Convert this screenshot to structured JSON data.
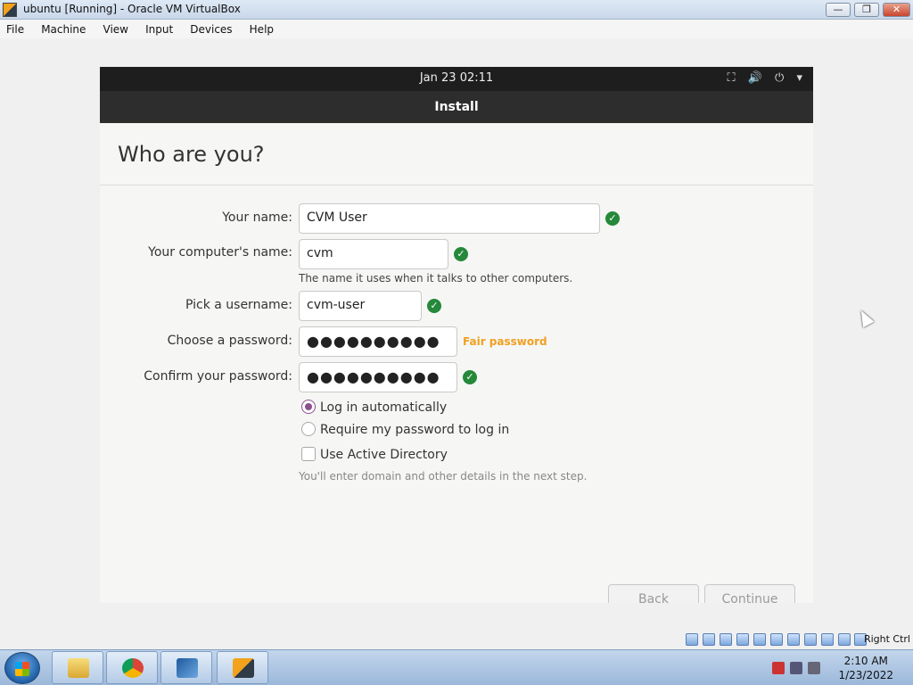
{
  "window": {
    "title": "ubuntu [Running] - Oracle VM VirtualBox",
    "minimize": "—",
    "maximize": "❐",
    "close": "✕"
  },
  "menu": [
    "File",
    "Machine",
    "View",
    "Input",
    "Devices",
    "Help"
  ],
  "guest": {
    "clock": "Jan 23  02:11",
    "tray_icons": [
      "network-icon",
      "volume-icon",
      "power-icon",
      "dropdown-icon"
    ],
    "tray_glyphs": [
      "⛶",
      "🔊",
      "⏻",
      "▾"
    ],
    "header": "Install",
    "page_title": "Who are you?",
    "form": {
      "name_label": "Your name:",
      "name_value": "CVM User",
      "computer_label": "Your computer's name:",
      "computer_value": "cvm",
      "computer_hint": "The name it uses when it talks to other computers.",
      "username_label": "Pick a username:",
      "username_value": "cvm-user",
      "password_label": "Choose a password:",
      "password_value": "●●●●●●●●●●",
      "password_strength": "Fair password",
      "confirm_label": "Confirm your password:",
      "confirm_value": "●●●●●●●●●●",
      "check_glyph": "✓"
    },
    "login_options": {
      "auto": "Log in automatically",
      "require_password": "Require my password to log in",
      "selected": "auto"
    },
    "active_directory": {
      "label": "Use Active Directory",
      "checked": false,
      "hint": "You'll enter domain and other details in the next step."
    },
    "buttons": {
      "back": "Back",
      "continue": "Continue"
    }
  },
  "statusbar": {
    "host_key": "Right Ctrl"
  },
  "taskbar": {
    "apps": [
      "file-explorer",
      "chrome",
      "virtualbox-manager",
      "virtualbox-vm"
    ],
    "time": "2:10 AM",
    "date": "1/23/2022"
  },
  "colors": {
    "ok_green": "#25883a",
    "radio_accent": "#8b4f8e",
    "strength_orange": "#f0a020"
  }
}
